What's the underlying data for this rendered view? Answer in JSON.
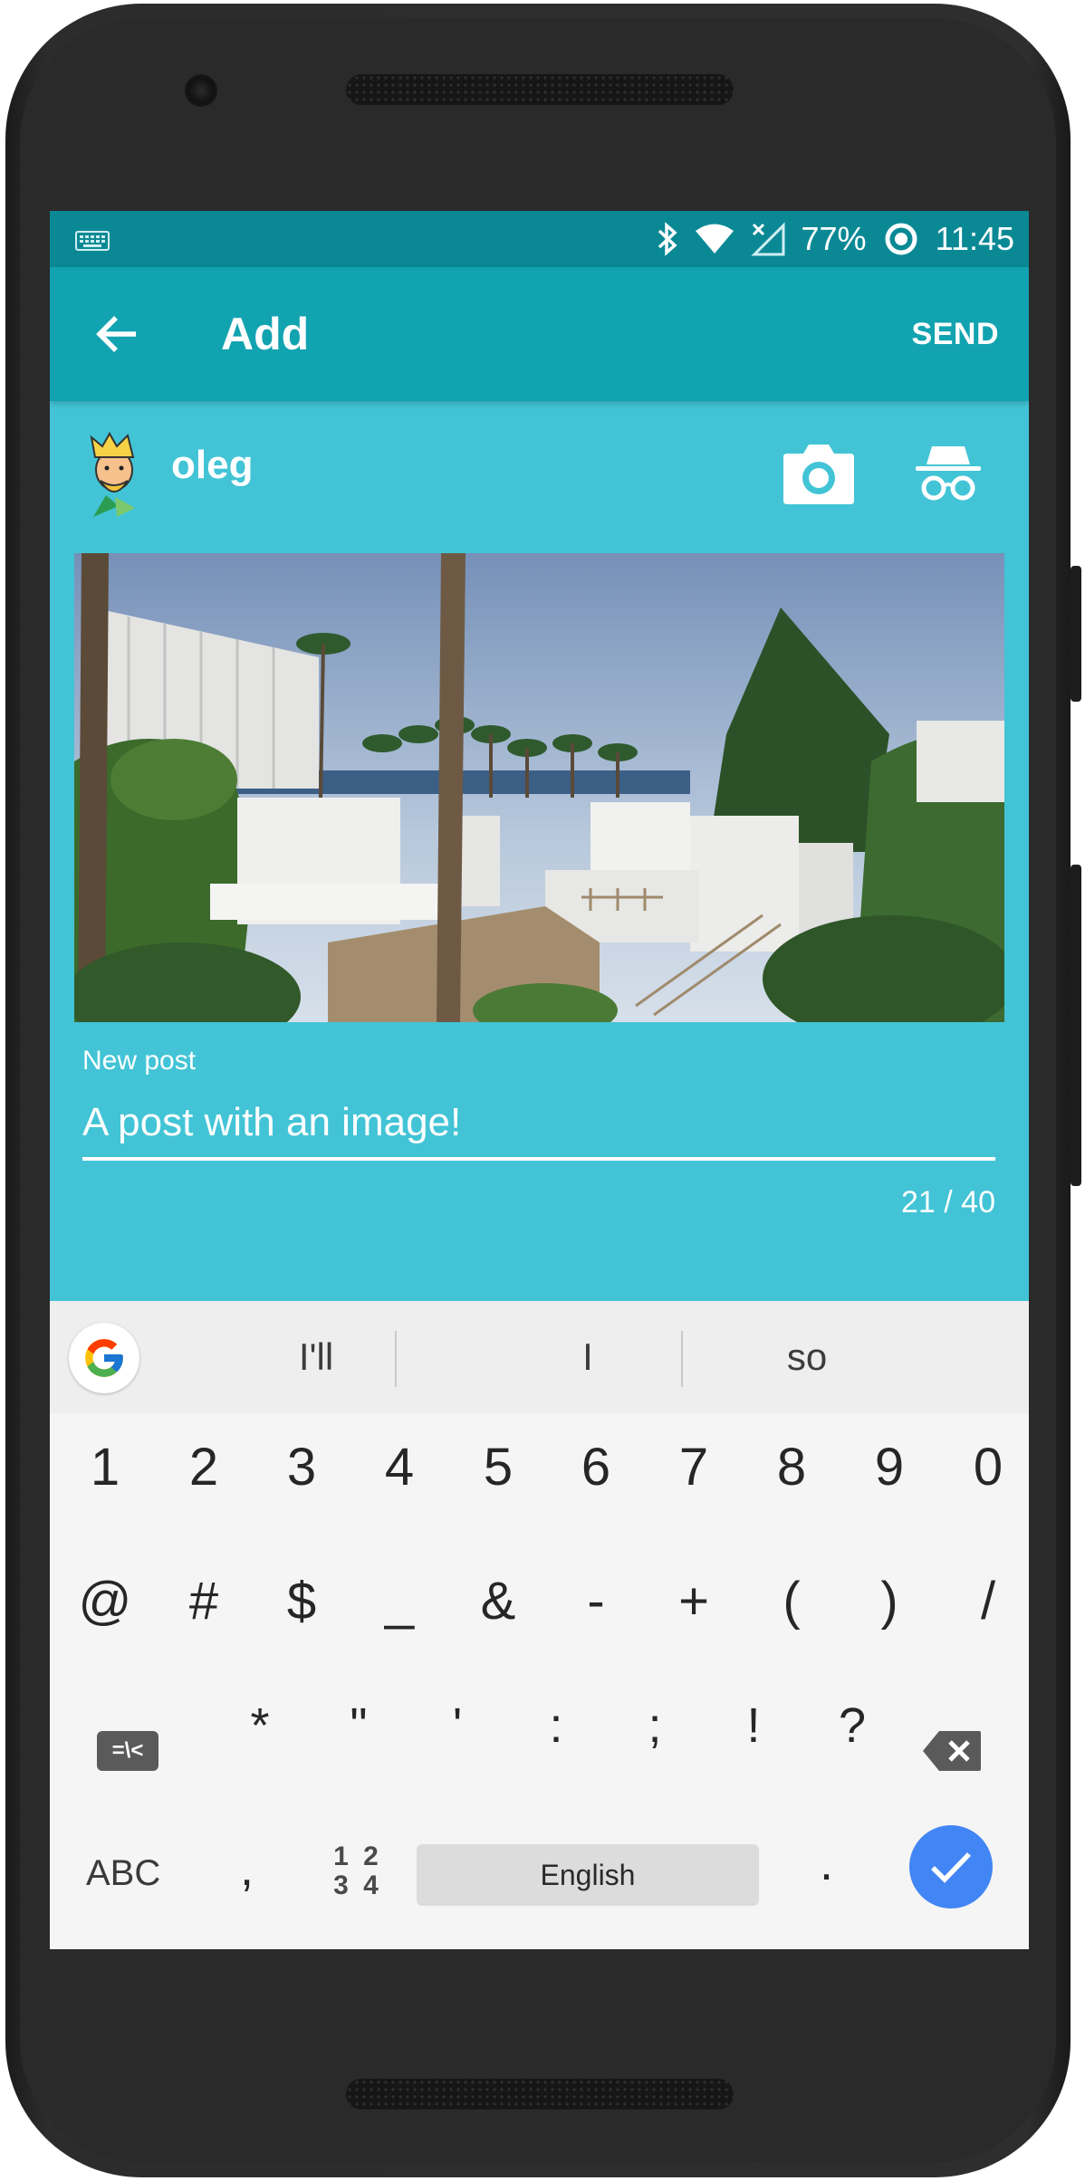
{
  "status_bar": {
    "battery": "77%",
    "time": "11:45",
    "icons": [
      "keyboard-icon",
      "bluetooth-icon",
      "wifi-icon",
      "no-signal-icon",
      "battery-saver-icon"
    ]
  },
  "app_bar": {
    "title": "Add",
    "send_label": "SEND",
    "back_icon": "arrow-back-icon"
  },
  "author": {
    "name": "oleg",
    "avatar_icon": "king-avatar-icon",
    "camera_icon": "camera-icon",
    "incognito_icon": "incognito-icon"
  },
  "post": {
    "label": "New post",
    "value": "A post with an image!",
    "counter": "21 / 40"
  },
  "keyboard": {
    "suggestions": [
      "I'll",
      "I",
      "so"
    ],
    "row1": [
      "1",
      "2",
      "3",
      "4",
      "5",
      "6",
      "7",
      "8",
      "9",
      "0"
    ],
    "row2": [
      "@",
      "#",
      "$",
      "_",
      "&",
      "-",
      "+",
      "(",
      ")",
      "/"
    ],
    "row3": [
      "*",
      "\"",
      "'",
      ":",
      ";",
      "!",
      "?"
    ],
    "sym_label": "=\\<",
    "abc_label": "ABC",
    "comma": ",",
    "nums_label": "12\n34",
    "space_label": "English",
    "period": "."
  },
  "colors": {
    "status_bar": "#0a8995",
    "app_bar": "#12a3b0",
    "content_bg": "#42c4d6",
    "enter_key": "#4285f4"
  }
}
